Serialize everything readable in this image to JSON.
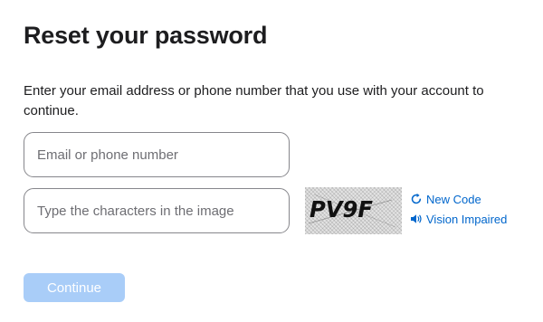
{
  "page": {
    "title": "Reset your password",
    "intro": "Enter your email address or phone number that you use with your account to continue."
  },
  "form": {
    "email_placeholder": "Email or phone number",
    "email_value": "",
    "captcha_placeholder": "Type the characters in the image",
    "captcha_value": "",
    "captcha_image_text": "PV9F",
    "new_code_label": "New Code",
    "vision_impaired_label": "Vision Impaired",
    "continue_label": "Continue"
  },
  "colors": {
    "text": "#1d1d1f",
    "link": "#0066cc",
    "button_disabled": "#a9cdf8",
    "field_border": "#86868b"
  },
  "icons": {
    "new_code": "refresh-icon",
    "vision_impaired": "speaker-icon"
  }
}
